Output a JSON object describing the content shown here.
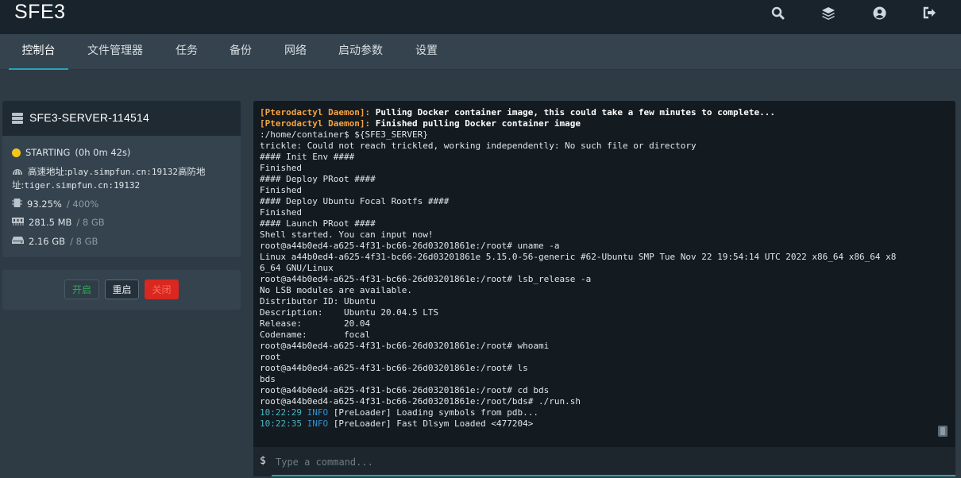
{
  "app": {
    "title": "SFE3"
  },
  "top_icons": [
    "search-icon",
    "layers-icon",
    "account-icon",
    "logout-icon"
  ],
  "tabs": [
    {
      "label": "控制台",
      "active": true
    },
    {
      "label": "文件管理器"
    },
    {
      "label": "任务"
    },
    {
      "label": "备份"
    },
    {
      "label": "网络"
    },
    {
      "label": "启动参数"
    },
    {
      "label": "设置"
    }
  ],
  "server": {
    "name": "SFE3-SERVER-114514",
    "status": "STARTING",
    "uptime": "(0h 0m 42s)",
    "address_label": "高速地址:",
    "address": "play.simpfun.cn:19132",
    "ddos_label": "高防地址:",
    "ddos_address": "tiger.simpfun.cn:19132",
    "cpu": "93.25%",
    "cpu_limit": "/ 400%",
    "memory": "281.5 MB",
    "memory_limit": "/ 8 GB",
    "disk": "2.16 GB",
    "disk_limit": "/ 8 GB",
    "status_color": "#f5c518"
  },
  "power": {
    "start_label": "开启",
    "restart_label": "重启",
    "stop_label": "关闭"
  },
  "console": {
    "lines": [
      {
        "type": "daemon",
        "prefix": "[Pterodactyl Daemon]:",
        "text": " Pulling Docker container image, this could take a few minutes to complete..."
      },
      {
        "type": "daemon",
        "prefix": "[Pterodactyl Daemon]:",
        "text": " Finished pulling Docker container image"
      },
      {
        "type": "plain",
        "text": ":/home/container$ ${SFE3_SERVER}"
      },
      {
        "type": "plain",
        "text": "trickle: Could not reach trickled, working independently: No such file or directory"
      },
      {
        "type": "plain",
        "text": "#### Init Env ####"
      },
      {
        "type": "plain",
        "text": "Finished"
      },
      {
        "type": "plain",
        "text": "#### Deploy PRoot ####"
      },
      {
        "type": "plain",
        "text": "Finished"
      },
      {
        "type": "plain",
        "text": "#### Deploy Ubuntu Focal Rootfs ####"
      },
      {
        "type": "plain",
        "text": "Finished"
      },
      {
        "type": "plain",
        "text": "#### Launch PRoot ####"
      },
      {
        "type": "plain",
        "text": "Shell started. You can input now!"
      },
      {
        "type": "plain",
        "text": "root@a44b0ed4-a625-4f31-bc66-26d03201861e:/root# uname -a"
      },
      {
        "type": "plain",
        "text": "Linux a44b0ed4-a625-4f31-bc66-26d03201861e 5.15.0-56-generic #62-Ubuntu SMP Tue Nov 22 19:54:14 UTC 2022 x86_64 x86_64 x8"
      },
      {
        "type": "plain",
        "text": "6_64 GNU/Linux"
      },
      {
        "type": "plain",
        "text": "root@a44b0ed4-a625-4f31-bc66-26d03201861e:/root# lsb_release -a"
      },
      {
        "type": "plain",
        "text": "No LSB modules are available."
      },
      {
        "type": "plain",
        "text": "Distributor ID: Ubuntu"
      },
      {
        "type": "plain",
        "text": "Description:    Ubuntu 20.04.5 LTS"
      },
      {
        "type": "plain",
        "text": "Release:        20.04"
      },
      {
        "type": "plain",
        "text": "Codename:       focal"
      },
      {
        "type": "plain",
        "text": "root@a44b0ed4-a625-4f31-bc66-26d03201861e:/root# whoami"
      },
      {
        "type": "plain",
        "text": "root"
      },
      {
        "type": "plain",
        "text": "root@a44b0ed4-a625-4f31-bc66-26d03201861e:/root# ls"
      },
      {
        "type": "plain",
        "text": "bds"
      },
      {
        "type": "plain",
        "text": "root@a44b0ed4-a625-4f31-bc66-26d03201861e:/root# cd bds"
      },
      {
        "type": "plain",
        "text": "root@a44b0ed4-a625-4f31-bc66-26d03201861e:/root/bds# ./run.sh"
      },
      {
        "type": "log",
        "time": "10:22:29",
        "level": "INFO",
        "text": " [PreLoader] Loading symbols from pdb..."
      },
      {
        "type": "log",
        "time": "10:22:35",
        "level": "INFO",
        "text": " [PreLoader] Fast Dlsym Loaded <477204>"
      }
    ],
    "prompt": "$",
    "placeholder": "Type a command..."
  },
  "colors": {
    "accent": "#25a5b8",
    "daemon": "#f6a440",
    "start": "#3aa65a",
    "stop": "#d9281f"
  }
}
